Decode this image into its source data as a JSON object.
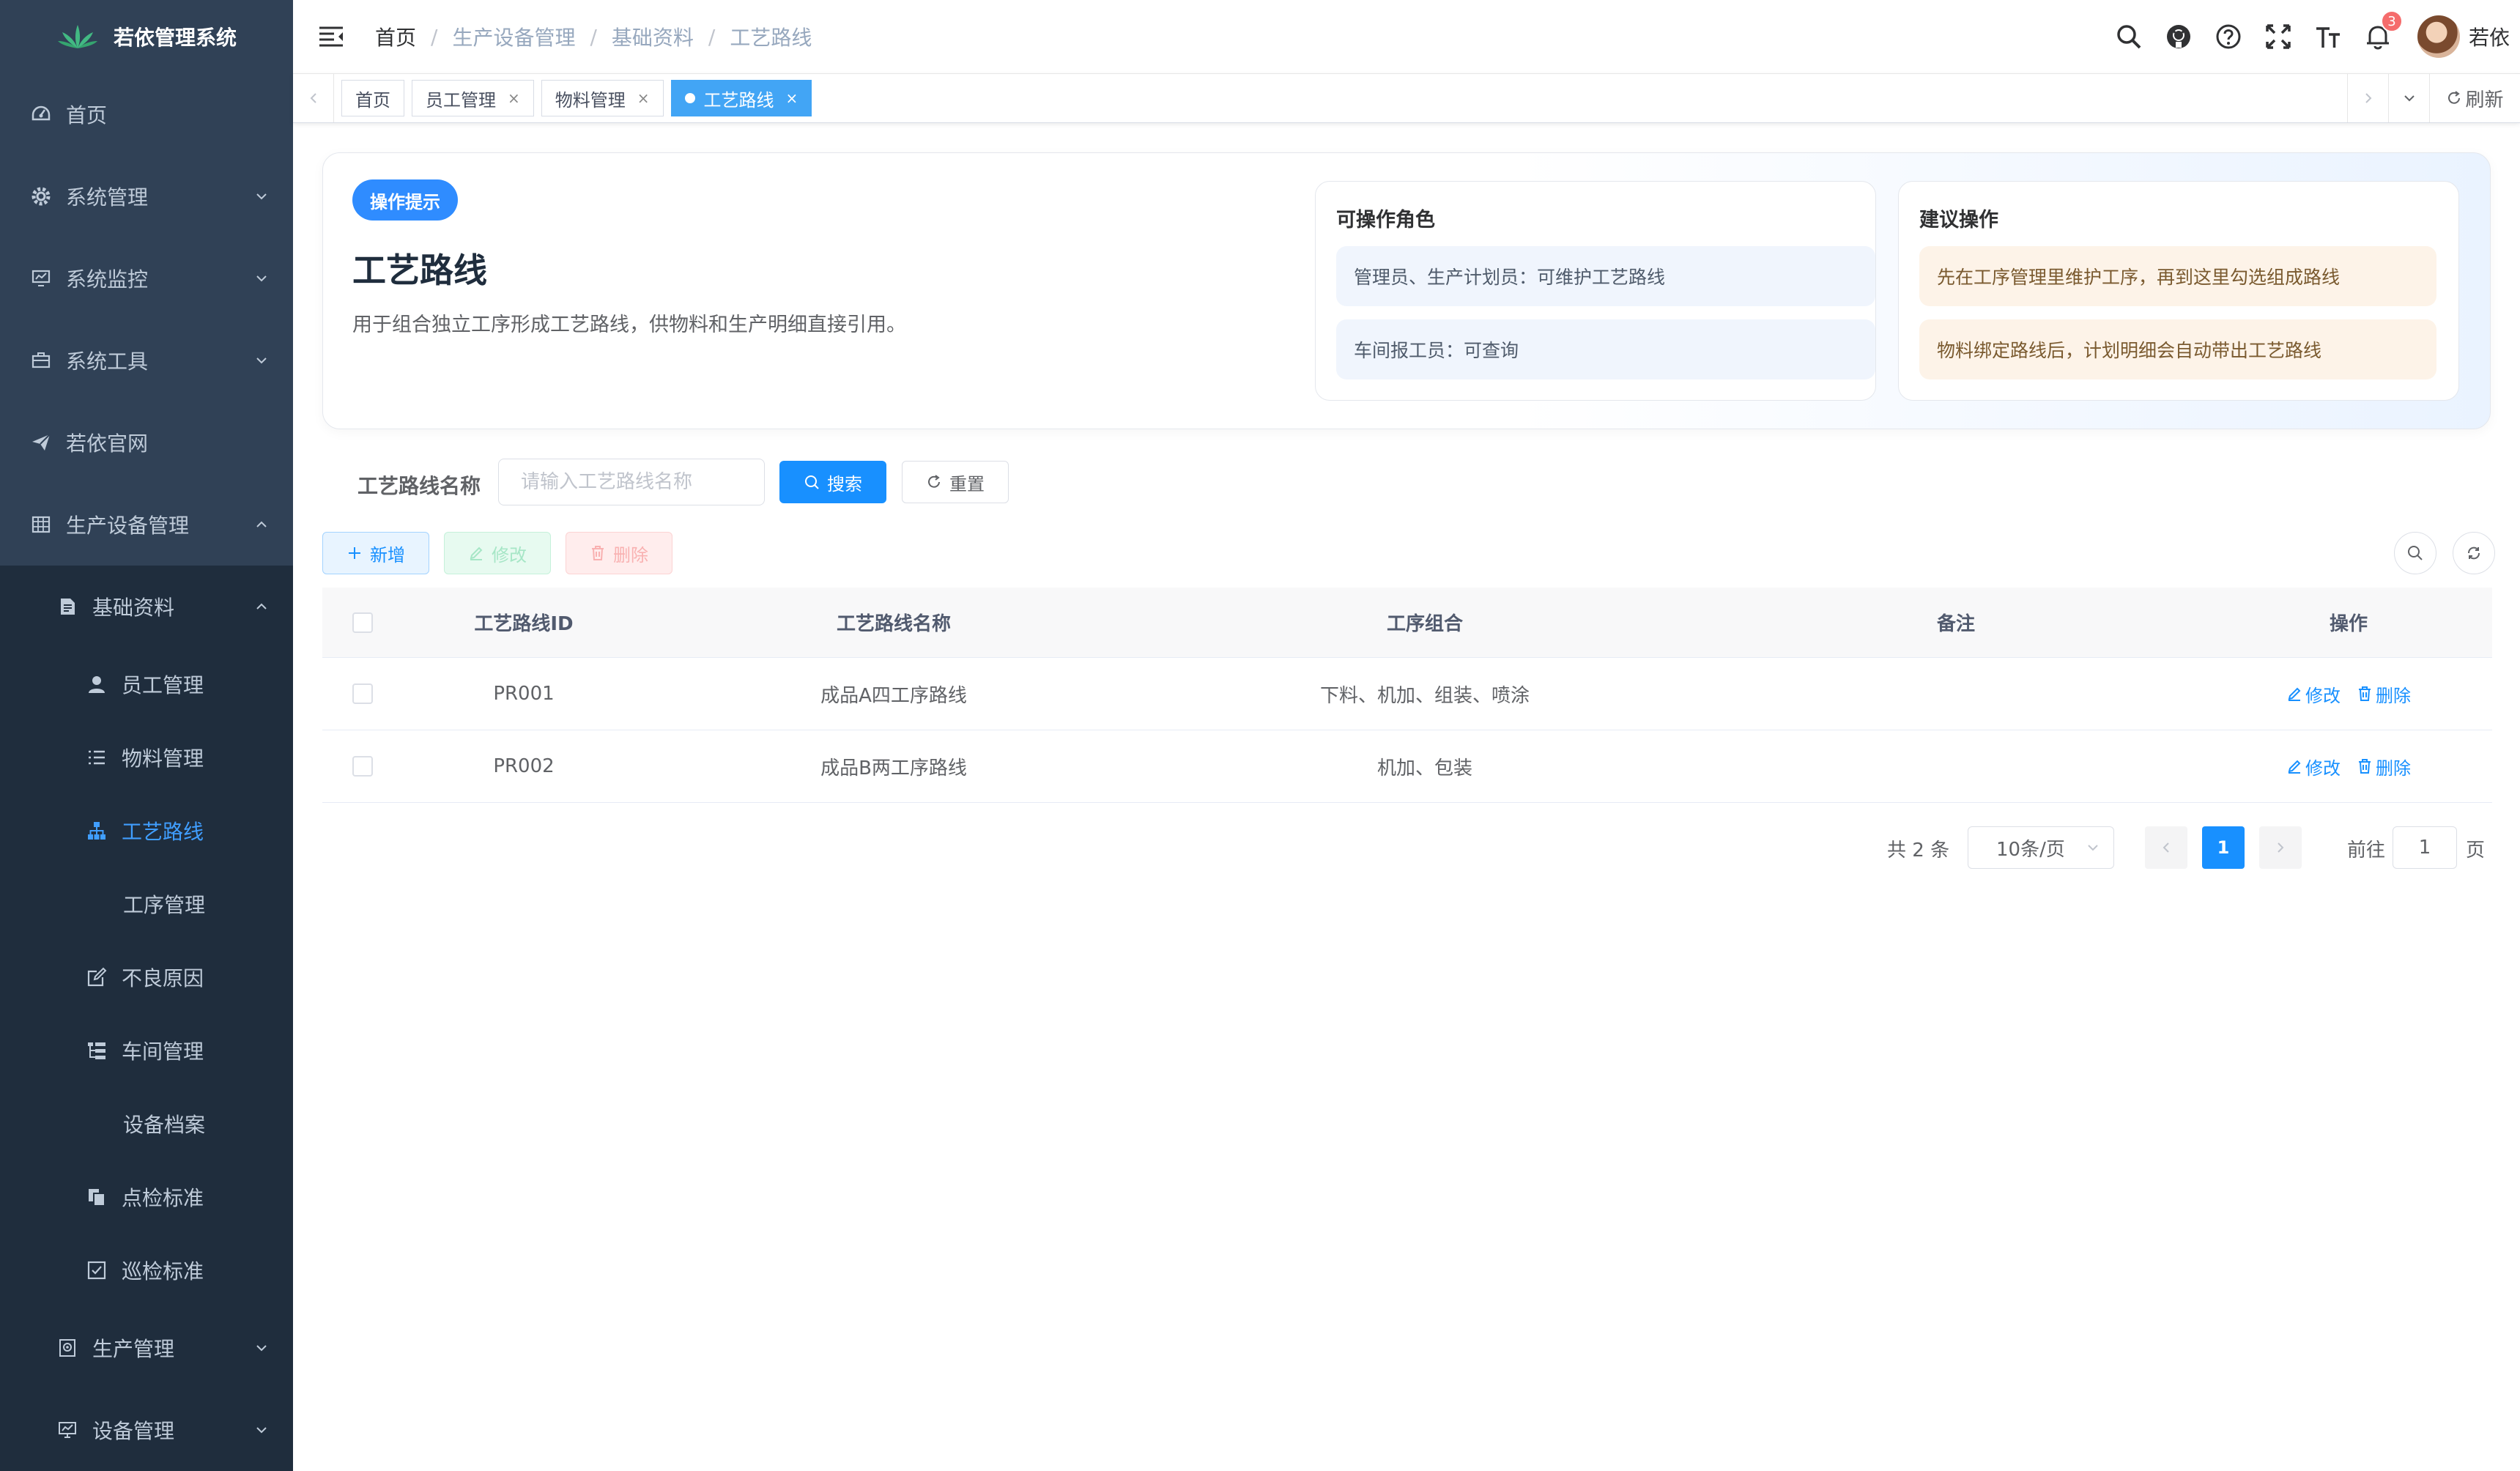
{
  "app": {
    "title": "若依管理系统"
  },
  "colors": {
    "sidebar_bg": "#304156",
    "submenu_bg": "#1f2d3d",
    "primary": "#1890ff",
    "active_text": "#409eff"
  },
  "sidebar": {
    "items": [
      {
        "label": "首页",
        "icon": "dashboard-icon"
      },
      {
        "label": "系统管理",
        "icon": "gear-icon"
      },
      {
        "label": "系统监控",
        "icon": "monitor-icon"
      },
      {
        "label": "系统工具",
        "icon": "toolbox-icon"
      },
      {
        "label": "若依官网",
        "icon": "send-icon"
      },
      {
        "label": "生产设备管理",
        "icon": "table-icon"
      }
    ],
    "group": {
      "label": "基础资料",
      "icon": "document-icon"
    },
    "sub_items": [
      {
        "label": "员工管理",
        "icon": "user-icon"
      },
      {
        "label": "物料管理",
        "icon": "list-icon"
      },
      {
        "label": "工艺路线",
        "icon": "tree-icon"
      },
      {
        "label": "工序管理",
        "icon": ""
      },
      {
        "label": "不良原因",
        "icon": "edit-icon"
      },
      {
        "label": "车间管理",
        "icon": "tree-table-icon"
      },
      {
        "label": "设备档案",
        "icon": ""
      },
      {
        "label": "点检标准",
        "icon": "copy-icon"
      },
      {
        "label": "巡检标准",
        "icon": "checkbox-icon"
      }
    ],
    "bottom_items": [
      {
        "label": "生产管理",
        "icon": "production-icon"
      },
      {
        "label": "设备管理",
        "icon": "device-icon"
      }
    ]
  },
  "breadcrumb": [
    "首页",
    "生产设备管理",
    "基础资料",
    "工艺路线"
  ],
  "header": {
    "notification_count": "3",
    "username": "若依"
  },
  "tags": {
    "items": [
      "首页",
      "员工管理",
      "物料管理",
      "工艺路线"
    ],
    "close_glyph": "×",
    "refresh_label": "刷新"
  },
  "hero": {
    "pill": "操作提示",
    "title": "工艺路线",
    "description": "用于组合独立工序形成工艺路线，供物料和生产明细直接引用。",
    "roles_title": "可操作角色",
    "roles": [
      "管理员、生产计划员：可维护工艺路线",
      "车间报工员：可查询"
    ],
    "advice_title": "建议操作",
    "advice": [
      "先在工序管理里维护工序，再到这里勾选组成路线",
      "物料绑定路线后，计划明细会自动带出工艺路线"
    ]
  },
  "search": {
    "label": "工艺路线名称",
    "placeholder": "请输入工艺路线名称",
    "search_button": "搜索",
    "reset_button": "重置"
  },
  "toolbar": {
    "add": "新增",
    "edit": "修改",
    "delete": "删除"
  },
  "table": {
    "columns": [
      "工艺路线ID",
      "工艺路线名称",
      "工序组合",
      "备注",
      "操作"
    ],
    "rows": [
      {
        "id": "PR001",
        "name": "成品A四工序路线",
        "processes": "下料、机加、组装、喷涂",
        "remark": ""
      },
      {
        "id": "PR002",
        "name": "成品B两工序路线",
        "processes": "机加、包装",
        "remark": ""
      }
    ],
    "op_edit": "修改",
    "op_delete": "删除"
  },
  "pagination": {
    "total_text": "共 2 条",
    "page_size": "10条/页",
    "current_page": "1",
    "goto_label": "前往",
    "goto_value": "1",
    "page_unit": "页"
  }
}
